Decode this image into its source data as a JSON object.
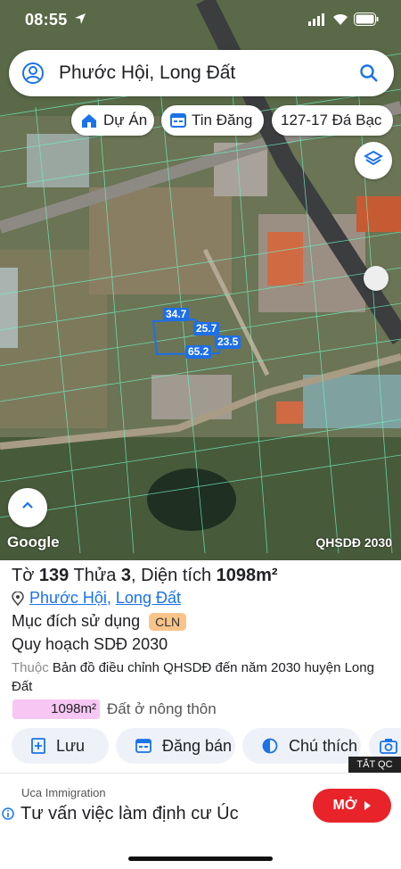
{
  "status_bar": {
    "time": "08:55"
  },
  "search": {
    "query": "Phước Hội, Long Đất"
  },
  "chips": [
    {
      "label": "Dự Án",
      "icon": "house-icon"
    },
    {
      "label": "Tin Đăng",
      "icon": "listing-icon"
    },
    {
      "label": "127-17 Đá Bạc"
    }
  ],
  "map": {
    "watermark": "Google",
    "layer_label": "QHSDĐ 2030",
    "dimensions": [
      "34.7",
      "25.7",
      "23.5",
      "65.2"
    ]
  },
  "parcel": {
    "sheet_prefix": "Tờ",
    "sheet_no": "139",
    "plot_prefix": "Thửa",
    "plot_no": "3",
    "area_prefix": ", Diện tích",
    "area_value": "1098m²",
    "ward": "Phước Hội",
    "district": "Long Đất",
    "purpose_label": "Mục đích sử dụng",
    "purpose_code": "CLN",
    "plan_label": "Quy hoạch SDĐ 2030",
    "belongs_prefix": "Thuộc",
    "belongs_text": "Bản đồ điều chỉnh QHSDĐ đến năm 2030 huyện Long Đất",
    "area_bar_value": "1098m²",
    "land_type": "Đất ở nông thôn"
  },
  "actions": [
    {
      "label": "Lưu",
      "icon": "save-icon"
    },
    {
      "label": "Đăng bán",
      "icon": "post-sale-icon"
    },
    {
      "label": "Chú thích",
      "icon": "legend-icon"
    }
  ],
  "ad": {
    "tag": "TẮT QC",
    "brand": "Uca Immigration",
    "headline": "Tư vấn việc làm định cư Úc",
    "cta": "MỞ"
  },
  "colors": {
    "accent_blue": "#1a73e8",
    "cln_badge": "#f9c48a",
    "area_bar": "#f7c6f2",
    "ad_cta": "#e8232a"
  }
}
